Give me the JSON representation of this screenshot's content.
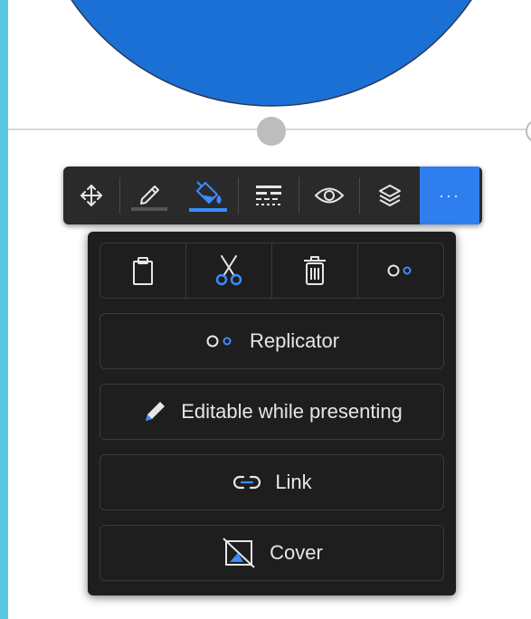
{
  "colors": {
    "accent": "#2f7ef0",
    "toolbar_bg": "#2a2a2a",
    "panel_bg": "#1e1e1e",
    "icon": "#e6e6e6",
    "icon_accent": "#3d8bff",
    "shape_fill": "#1b70d6"
  },
  "toolbar": {
    "items": [
      {
        "icon": "move-icon"
      },
      {
        "icon": "pen-color-icon"
      },
      {
        "icon": "fill-color-icon"
      },
      {
        "icon": "line-style-icon"
      },
      {
        "icon": "eye-icon"
      },
      {
        "icon": "layers-icon"
      },
      {
        "icon": "more-icon",
        "label": "···"
      }
    ]
  },
  "menu": {
    "quick_actions": [
      {
        "icon": "clipboard-icon"
      },
      {
        "icon": "scissors-icon"
      },
      {
        "icon": "trash-icon"
      },
      {
        "icon": "replicator-icon"
      }
    ],
    "items": [
      {
        "icon": "replicator-icon",
        "label": "Replicator"
      },
      {
        "icon": "pencil-icon",
        "label": "Editable while presenting"
      },
      {
        "icon": "link-icon",
        "label": "Link"
      },
      {
        "icon": "cover-icon",
        "label": "Cover"
      }
    ]
  }
}
